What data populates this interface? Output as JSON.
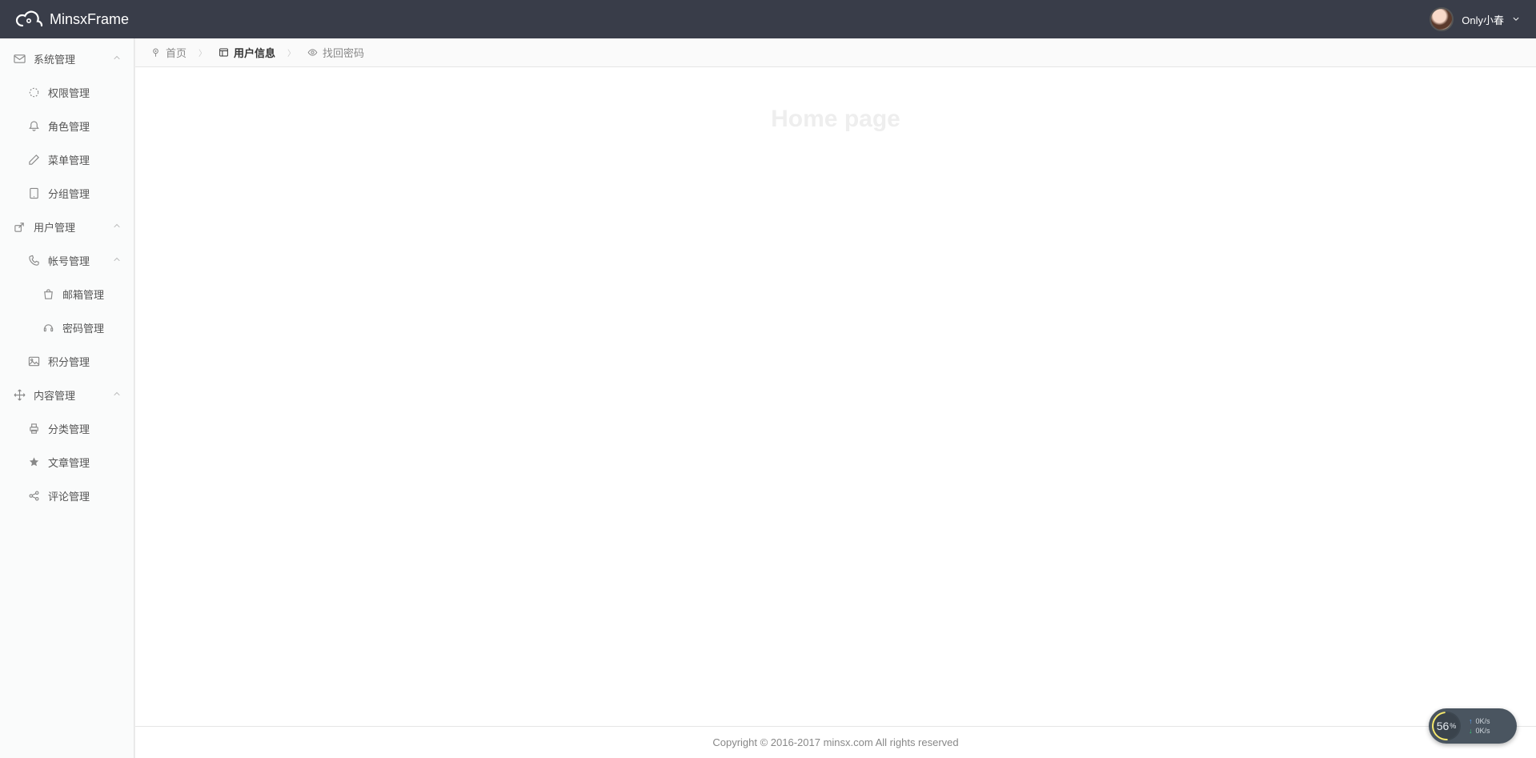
{
  "brand": {
    "name": "MinsxFrame"
  },
  "user": {
    "name": "Only小春"
  },
  "sidebar": {
    "groups": [
      {
        "label": "系统管理",
        "icon": "mail-icon",
        "expand": true,
        "children": [
          {
            "label": "权限管理",
            "icon": "loading-icon"
          },
          {
            "label": "角色管理",
            "icon": "bell-icon"
          },
          {
            "label": "菜单管理",
            "icon": "pencil-icon"
          },
          {
            "label": "分组管理",
            "icon": "tablet-icon"
          }
        ]
      },
      {
        "label": "用户管理",
        "icon": "export-icon",
        "expand": true,
        "children": [
          {
            "label": "帐号管理",
            "icon": "phone-icon",
            "expand": true,
            "children": [
              {
                "label": "邮箱管理",
                "icon": "bag-icon"
              },
              {
                "label": "密码管理",
                "icon": "headset-icon"
              }
            ]
          },
          {
            "label": "积分管理",
            "icon": "image-icon"
          }
        ]
      },
      {
        "label": "内容管理",
        "icon": "move-icon",
        "expand": true,
        "children": [
          {
            "label": "分类管理",
            "icon": "printer-icon"
          },
          {
            "label": "文章管理",
            "icon": "star-icon"
          },
          {
            "label": "评论管理",
            "icon": "share-icon"
          }
        ]
      }
    ]
  },
  "tabs": {
    "items": [
      {
        "label": "首页",
        "icon": "pin-icon",
        "active": false,
        "closable": false
      },
      {
        "label": "用户信息",
        "icon": "layout-icon",
        "active": true,
        "closable": false
      },
      {
        "label": "找回密码",
        "icon": "eye-icon",
        "active": false,
        "closable": false
      }
    ]
  },
  "content": {
    "home_title": "Home page"
  },
  "footer": {
    "text": "Copyright © 2016-2017 minsx.com All rights reserved"
  },
  "netwidget": {
    "percent": "56",
    "percent_suffix": "%",
    "up": "0K/s",
    "down": "0K/s"
  }
}
